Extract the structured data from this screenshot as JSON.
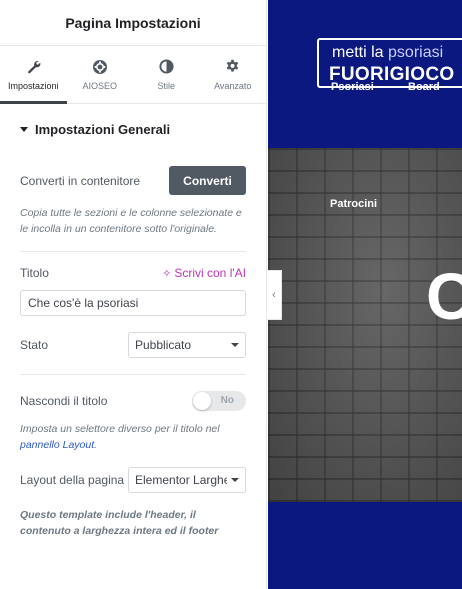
{
  "panel": {
    "title": "Pagina Impostazioni",
    "tabs": [
      {
        "label": "Impostazioni",
        "icon": "wrench-icon",
        "active": true
      },
      {
        "label": "AIOSEO",
        "icon": "aioseo-icon",
        "active": false
      },
      {
        "label": "Stile",
        "icon": "half-circle-icon",
        "active": false
      },
      {
        "label": "Avanzato",
        "icon": "gear-icon",
        "active": false
      }
    ],
    "section_title": "Impostazioni Generali",
    "convert": {
      "label": "Converti in contenitore",
      "button": "Converti",
      "description": "Copia tutte le sezioni e le colonne selezionate e le incolla in un contenitore sotto l'originale."
    },
    "title_field": {
      "label": "Titolo",
      "ai_link": "Scrivi con l'AI",
      "value": "Che cos'è la psoriasi"
    },
    "status": {
      "label": "Stato",
      "value": "Pubblicato"
    },
    "hide_title": {
      "label": "Nascondi il titolo",
      "toggle_text": "No",
      "description_prefix": "Imposta un selettore diverso per il titolo nel",
      "description_link": "pannello Layout",
      "description_suffix": "."
    },
    "layout": {
      "label": "Layout della pagina",
      "value": "Elementor Larghezza",
      "description": "Questo template include l'header, il contenuto a larghezza intera ed il footer"
    }
  },
  "preview": {
    "logo_line1_bold": "metti la",
    "logo_line1_thin": "psoriasi",
    "logo_line2": "FUORIGIOCO",
    "nav": [
      "Psoriasi",
      "Board",
      "Patrocini"
    ],
    "hero_text": "C",
    "colors": {
      "brand_blue": "#0b1880",
      "ai_pink": "#c036b5",
      "button_dark": "#515962"
    }
  }
}
